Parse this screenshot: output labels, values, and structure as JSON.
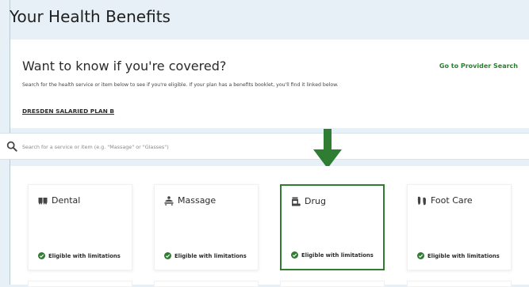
{
  "page": {
    "title": "Your Health Benefits"
  },
  "coverage": {
    "heading": "Want to know if you're covered?",
    "provider_link": "Go to Provider Search",
    "description": "Search for the health service or item below to see if you're eligible. If your plan has a benefits booklet, you'll find it linked below.",
    "plan_link": "DRESDEN SALARIED PLAN B"
  },
  "search": {
    "placeholder": "Search for a service or item (e.g. \"Massage\" or \"Glasses\")",
    "value": ""
  },
  "tiles": [
    {
      "name": "Dental",
      "icon": "teeth-icon",
      "status": "Eligible with limitations"
    },
    {
      "name": "Massage",
      "icon": "massage-icon",
      "status": "Eligible with limitations"
    },
    {
      "name": "Drug",
      "icon": "pill-bottle-icon",
      "status": "Eligible with limitations",
      "highlighted": true
    },
    {
      "name": "Foot Care",
      "icon": "footprints-icon",
      "status": "Eligible with limitations"
    }
  ],
  "colors": {
    "accent": "#2e7d32",
    "background": "#e6f0f6"
  }
}
